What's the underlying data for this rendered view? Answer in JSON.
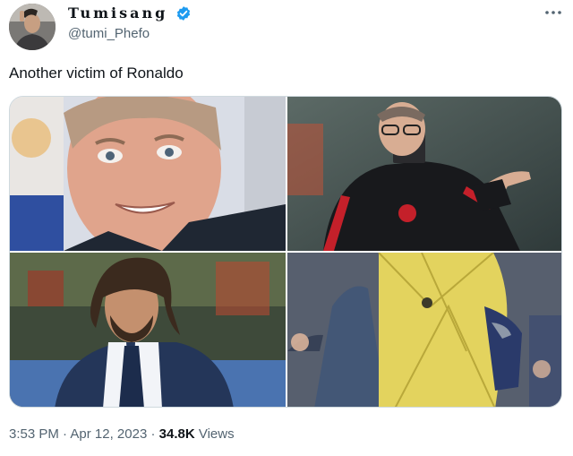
{
  "author": {
    "display_name": "Tumisang",
    "handle": "@tumi_Phefo",
    "verified": true,
    "avatar_icon": "avatar-photo"
  },
  "tweet": {
    "text": "Another victim of Ronaldo",
    "images": [
      {
        "name": "photo-smiling-coach-navy-jacket"
      },
      {
        "name": "photo-coach-glasses-pointing"
      },
      {
        "name": "photo-bearded-man-suit"
      },
      {
        "name": "photo-man-yellow-training-top"
      }
    ]
  },
  "meta": {
    "time": "3:53 PM",
    "separator": "·",
    "date": "Apr 12, 2023",
    "views_count": "34.8K",
    "views_label": "Views"
  },
  "icons": {
    "more": "more-dots-icon",
    "verified": "verified-badge-icon"
  },
  "colors": {
    "verified_blue": "#1d9bf0",
    "secondary_text": "#536471",
    "primary_text": "#0f1419"
  }
}
